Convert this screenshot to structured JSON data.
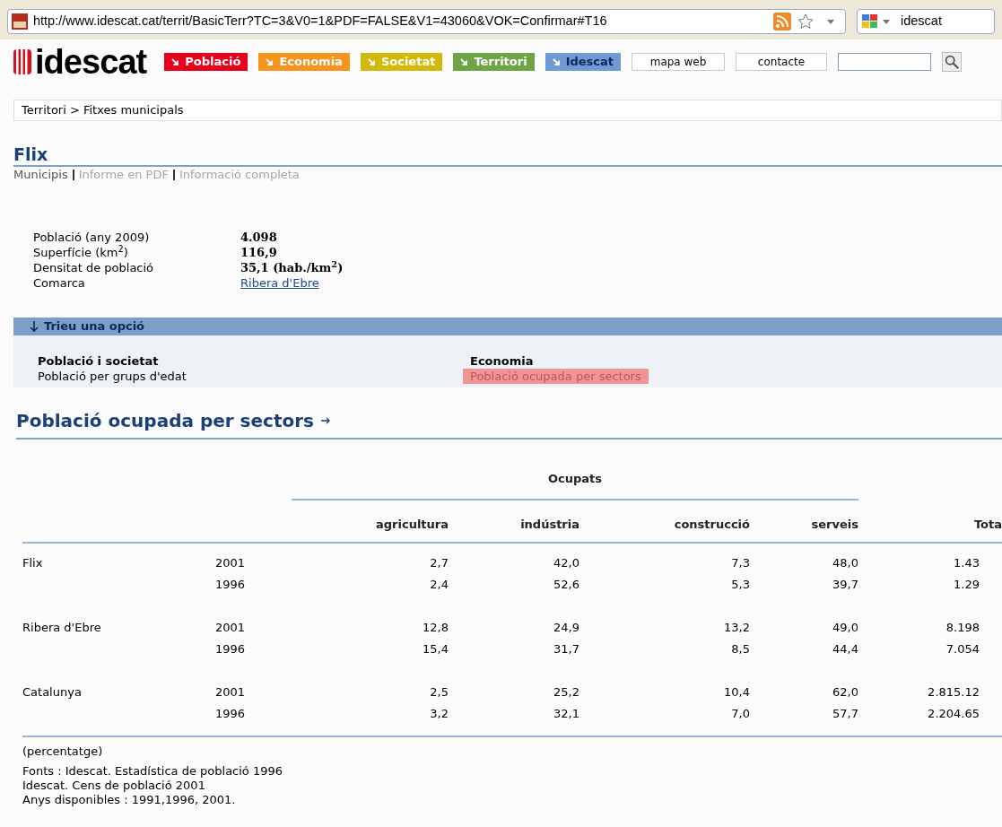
{
  "browser": {
    "url": "http://www.idescat.cat/territ/BasicTerr?TC=3&V0=1&PDF=FALSE&V1=43060&VOK=Confirmar#T16",
    "search_value": "idescat"
  },
  "header": {
    "logo": "idescat",
    "nav": [
      {
        "label": "Població",
        "color": "#e8001c"
      },
      {
        "label": "Economia",
        "color": "#f7941d"
      },
      {
        "label": "Societat",
        "color": "#d2b90a"
      },
      {
        "label": "Territori",
        "color": "#6da544"
      },
      {
        "label": "Idescat",
        "color": "#6f9ad6"
      }
    ],
    "links": [
      "mapa web",
      "contacte"
    ]
  },
  "breadcrumb": "Territori > Fitxes municipals",
  "title": "Flix",
  "sublinks": [
    {
      "label": "Municipis",
      "disabled": false
    },
    {
      "label": "Informe en PDF",
      "disabled": true
    },
    {
      "label": "Informació completa",
      "disabled": true
    }
  ],
  "facts": [
    {
      "label": "Població (any 2009)",
      "value": "4.098",
      "kind": "text"
    },
    {
      "label": "Superfície (km$^{2}$)",
      "value": "116,9",
      "kind": "text"
    },
    {
      "label": "Densitat de població",
      "value": "35,1 (hab./km$^{2}$)",
      "kind": "text"
    },
    {
      "label": "Comarca",
      "value": "Ribera d'Ebre",
      "kind": "link"
    }
  ],
  "options": {
    "title": "Trieu una opció",
    "groups": [
      {
        "heading": "Població i societat",
        "items": [
          {
            "label": "Població per grups d'edat",
            "selected": false
          }
        ]
      },
      {
        "heading": "Economia",
        "items": [
          {
            "label": "Població ocupada per sectors",
            "selected": true
          }
        ]
      }
    ]
  },
  "section_title": "Població ocupada per sectors",
  "table": {
    "group_header": "Ocupats",
    "columns": [
      "agricultura",
      "indústria",
      "construcció",
      "serveis",
      "Tota"
    ],
    "groups": [
      {
        "name": "Flix",
        "rows": [
          [
            "2001",
            "2,7",
            "42,0",
            "7,3",
            "48,0",
            "1.43"
          ],
          [
            "1996",
            "2,4",
            "52,6",
            "5,3",
            "39,7",
            "1.29"
          ]
        ]
      },
      {
        "name": "Ribera d'Ebre",
        "rows": [
          [
            "2001",
            "12,8",
            "24,9",
            "13,2",
            "49,0",
            "8.198"
          ],
          [
            "1996",
            "15,4",
            "31,7",
            "8,5",
            "44,4",
            "7.054"
          ]
        ]
      },
      {
        "name": "Catalunya",
        "rows": [
          [
            "2001",
            "2,5",
            "25,2",
            "10,4",
            "62,0",
            "2.815.12"
          ],
          [
            "1996",
            "3,2",
            "32,1",
            "7,0",
            "57,7",
            "2.204.65"
          ]
        ]
      }
    ]
  },
  "notes": {
    "unit": "(percentatge)",
    "lines": [
      "Fonts : Idescat. Estadística de població 1996",
      "Idescat. Cens de població 2001",
      "Anys disponibles : 1991,1996, 2001."
    ]
  }
}
